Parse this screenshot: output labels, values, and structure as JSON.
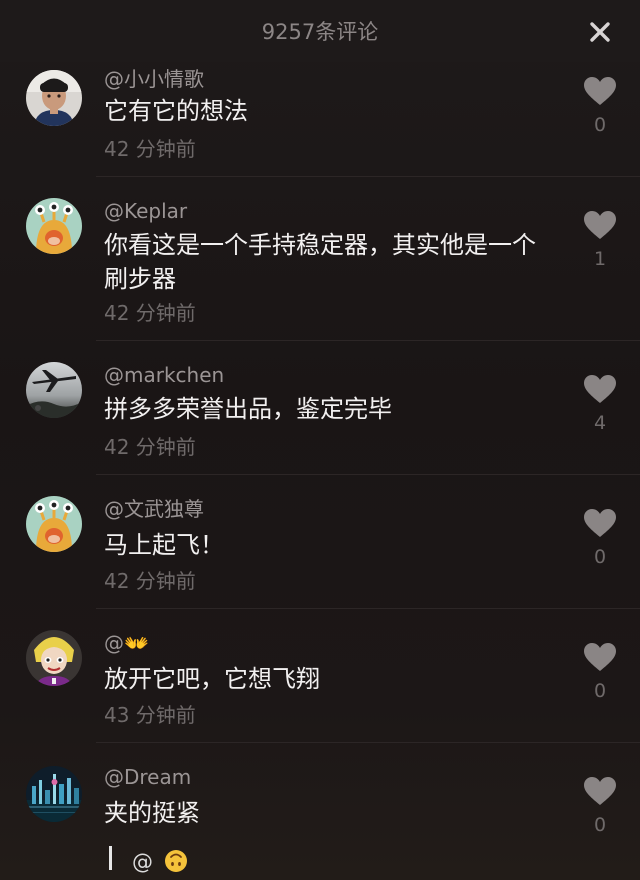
{
  "header": {
    "title": "9257条评论",
    "close_icon": "close-icon"
  },
  "comments": [
    {
      "username": "@小小情歌",
      "content": "它有它的想法",
      "time": "42 分钟前",
      "likes": "0",
      "avatar": "avatar-photo-boy"
    },
    {
      "username": "@Keplar",
      "content": "你看这是一个手持稳定器，其实他是一个刷步器",
      "time": "42 分钟前",
      "likes": "1",
      "avatar": "avatar-green-monster"
    },
    {
      "username": "@markchen",
      "content": "拼多多荣誉出品，鉴定完毕",
      "time": "42 分钟前",
      "likes": "4",
      "avatar": "avatar-airplane"
    },
    {
      "username": "@文武独尊",
      "content": "马上起飞！",
      "time": "42 分钟前",
      "likes": "0",
      "avatar": "avatar-green-monster"
    },
    {
      "username": "@👐",
      "content": "放开它吧，它想飞翔",
      "time": "43 分钟前",
      "likes": "0",
      "avatar": "avatar-cartoon-face"
    },
    {
      "username": "@Dream",
      "content": "夹的挺紧",
      "time": "",
      "likes": "0",
      "avatar": "avatar-city-night"
    }
  ],
  "input": {
    "text": "@",
    "emoji": "upside-down-face"
  },
  "colors": {
    "background": "#1b1616",
    "text_primary": "#f2f0f0",
    "text_secondary": "#9b9595",
    "text_muted": "#6f6a6a",
    "heart": "#8a8585"
  }
}
